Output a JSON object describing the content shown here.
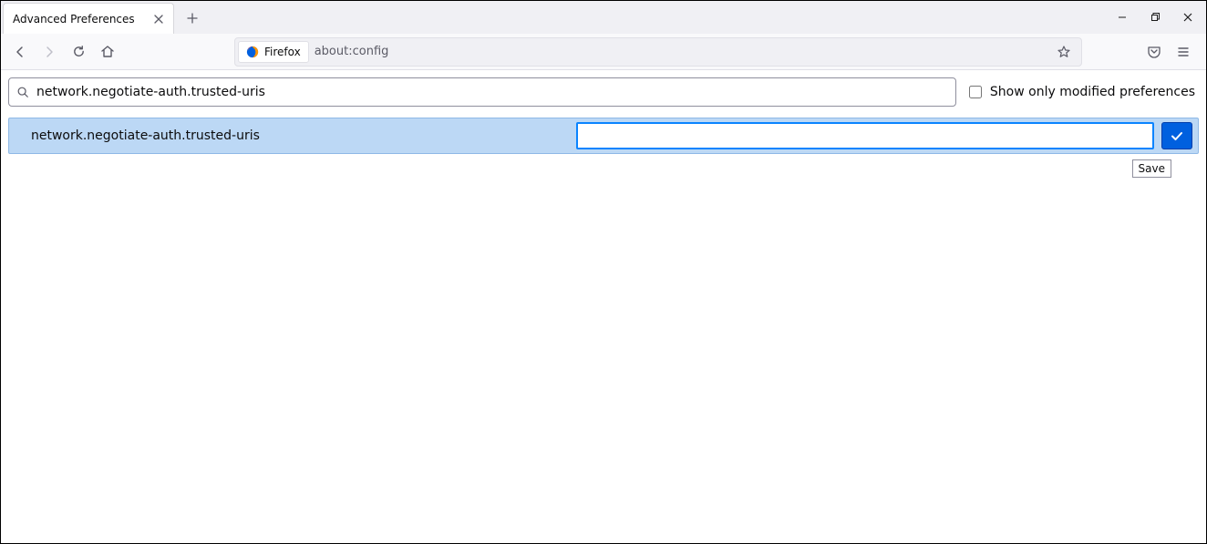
{
  "window": {
    "tab_title": "Advanced Preferences"
  },
  "toolbar": {
    "identity_label": "Firefox",
    "url": "about:config"
  },
  "content": {
    "search_value": "network.negotiate-auth.trusted-uris",
    "show_modified_label": "Show only modified preferences",
    "pref_name": "network.negotiate-auth.trusted-uris",
    "pref_value": "",
    "save_tooltip": "Save"
  }
}
